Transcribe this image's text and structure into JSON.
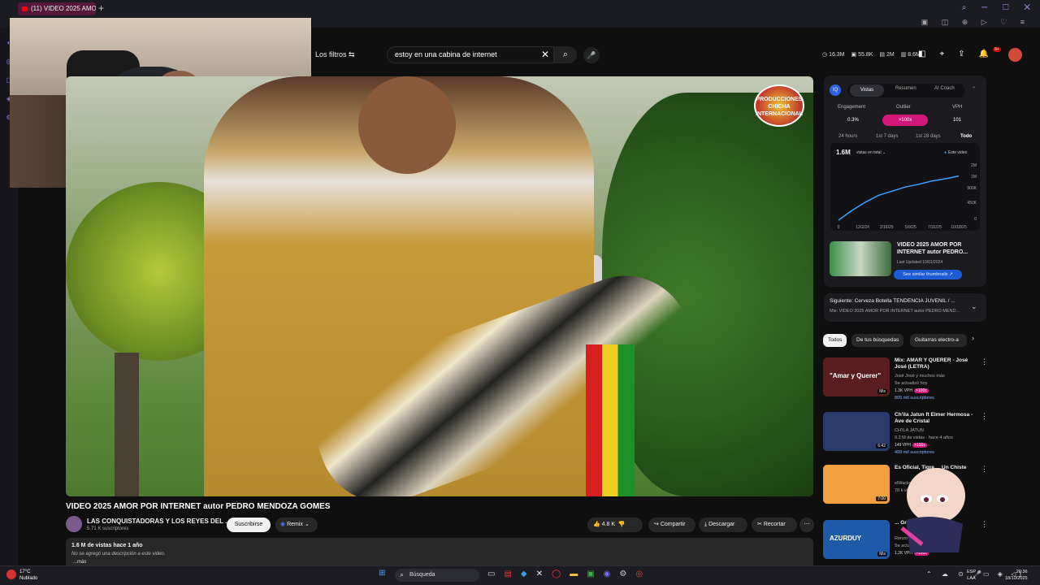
{
  "browser": {
    "tab_title": "(11) VIDEO 2025 AMOR PO",
    "new_tab": "+"
  },
  "header": {
    "filters_label": "Los filtros",
    "search_value": "estoy en una cabina de internet",
    "stats": [
      "16.3M",
      "55.8K",
      "2M",
      "8.6M"
    ],
    "notif_count": "9+"
  },
  "video": {
    "logo_text": "PRODUCCIONES CHICHA INTERNACIONAL",
    "title": "VIDEO 2025 AMOR POR INTERNET autor PEDRO MENDOZA GOMES",
    "channel_name": "LAS CONQUISTADORAS Y LOS REYES DEL ...",
    "subscribers": "5.71 K suscriptores",
    "subscribe_label": "Suscribirse",
    "remix_label": "Remix",
    "likes": "4.8 K",
    "share_label": "Compartir",
    "download_label": "Descargar",
    "trim_label": "Recortar",
    "views_line": "1.6 M de vistas  hace 1 año",
    "description": "No se agregó una descripción a este video.",
    "more_label": "...más"
  },
  "panel": {
    "iq_label": "IQ",
    "tabs": [
      "Vistas",
      "Resumen",
      "AI Coach"
    ],
    "metrics": [
      {
        "label": "Engagement",
        "value": "0.3%"
      },
      {
        "label": "Outlier",
        "value": ">100x"
      },
      {
        "label": "VPH",
        "value": "101"
      }
    ],
    "ranges": [
      "24 hours",
      "1st 7 days",
      "1st 28 days",
      "Todo"
    ],
    "chart_total": "1.6M",
    "chart_metric": "vistas en total",
    "chart_legend": "Este video",
    "similar": {
      "title": "VIDEO 2025 AMOR POR INTERNET autor PEDRO...",
      "updated": "Last Updated 10/01/2024",
      "button": "See similar thumbnails"
    }
  },
  "chart_data": {
    "type": "line",
    "x_ticks": [
      "0",
      "12/2/24",
      "2/16/25",
      "5/9/25",
      "7/31/25",
      "10/18/25"
    ],
    "y_ticks": [
      "0",
      "450K",
      "900K",
      "1M",
      "2M"
    ],
    "series": [
      {
        "name": "Este video",
        "values": [
          0,
          350000,
          650000,
          900000,
          1050000,
          1200000,
          1300000,
          1420000,
          1500000,
          1600000
        ]
      }
    ],
    "title": "",
    "xlabel": "",
    "ylabel": "",
    "ylim": [
      0,
      2000000
    ],
    "grid": false,
    "legend": "top-right"
  },
  "upnext": {
    "title": "Siguiente: Cerveza Botella TENDENCIA JUVENIL / ...",
    "subtitle": "Mix: VIDEO 2025 AMOR POR INTERNET autor PEDRO MEND..."
  },
  "chips": [
    "Todos",
    "De tus búsquedas",
    "Guitarras electro-a"
  ],
  "recommendations": [
    {
      "title": "Mix: AMAR Y QUERER - José José (LETRA)",
      "meta": "José José y muchos más",
      "meta2": "Se actualizó hoy",
      "vph": "1.3K VPH",
      "outlier": ">100x",
      "subs": "805 mil suscriptores",
      "thumb_text": "\"Amar y Querer\"",
      "badge": "Mix",
      "thumb_color": "#5a1d1d"
    },
    {
      "title": "Ch'ila Jatun ft Elmer Hermosa - Ave de Cristal",
      "meta": "CH'ILA JATUN",
      "meta2": "9.2 M de vistas · hace 4 años",
      "vph": "149 VPH",
      "outlier": ">100x",
      "subs": "499 mil suscriptores",
      "thumb_text": "",
      "badge": "6:42",
      "thumb_color": "#2a3a6a"
    },
    {
      "title": "Es Oficial, Tigre ... Un Chiste",
      "meta": "elWacky",
      "meta2": "70 k vi...",
      "vph": "",
      "outlier": "",
      "subs": "",
      "thumb_text": "",
      "badge": "7:00",
      "thumb_color": "#f0a040"
    },
    {
      "title": "... Grupo Los ... uy",
      "meta": "Renzo ... Grupo Hermanos ...",
      "meta2": "Se actualizó hoy",
      "vph": "1.2K VPH",
      "outlier": ">100x",
      "subs": "",
      "thumb_text": "AZURDUY",
      "badge": "Mix",
      "thumb_color": "#1e5aa8"
    }
  ],
  "taskbar": {
    "temp": "17°C",
    "weather": "Nublado",
    "search_label": "Búsqueda",
    "lang": "ESP",
    "lang2": "LAA",
    "time": "20:36",
    "date": "18/10/2025"
  },
  "colors": {
    "accent": "#d1187a",
    "brand_red": "#ff0000",
    "chart_line": "#3da1ff",
    "panel_bg": "#1b1b20"
  }
}
